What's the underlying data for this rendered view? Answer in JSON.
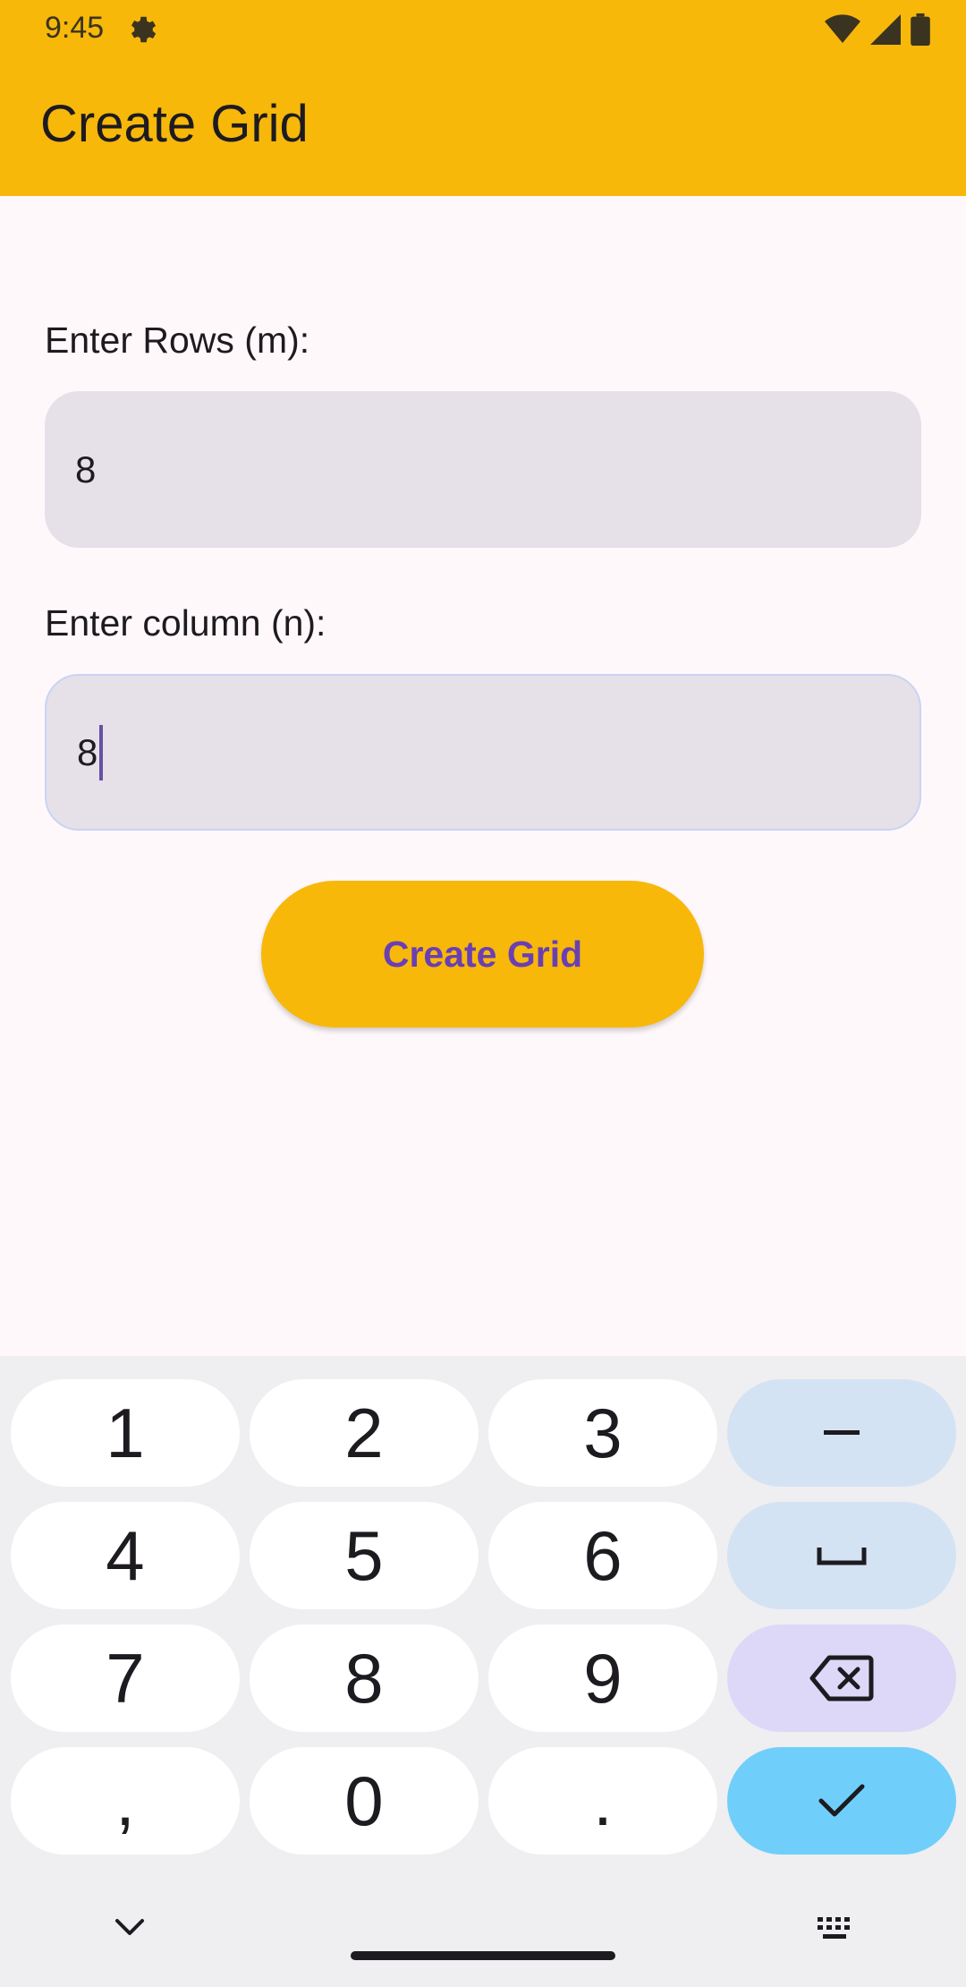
{
  "status_bar": {
    "time": "9:45"
  },
  "app_bar": {
    "title": "Create Grid"
  },
  "form": {
    "rows_label": "Enter Rows (m):",
    "rows_value": "8",
    "columns_label": "Enter column (n):",
    "columns_value": "8",
    "submit_label": "Create Grid"
  },
  "keyboard": {
    "row1": [
      "1",
      "2",
      "3"
    ],
    "row2": [
      "4",
      "5",
      "6"
    ],
    "row3": [
      "7",
      "8",
      "9"
    ],
    "row4": [
      ",",
      "0",
      "."
    ],
    "function_keys": [
      "minus-icon",
      "space-icon",
      "backspace-icon",
      "check-icon"
    ]
  },
  "colors": {
    "accent": "#F7B80A",
    "button_text": "#6A3FB4",
    "field_bg": "#E6E0E9",
    "enter_key": "#6FCFFA"
  }
}
